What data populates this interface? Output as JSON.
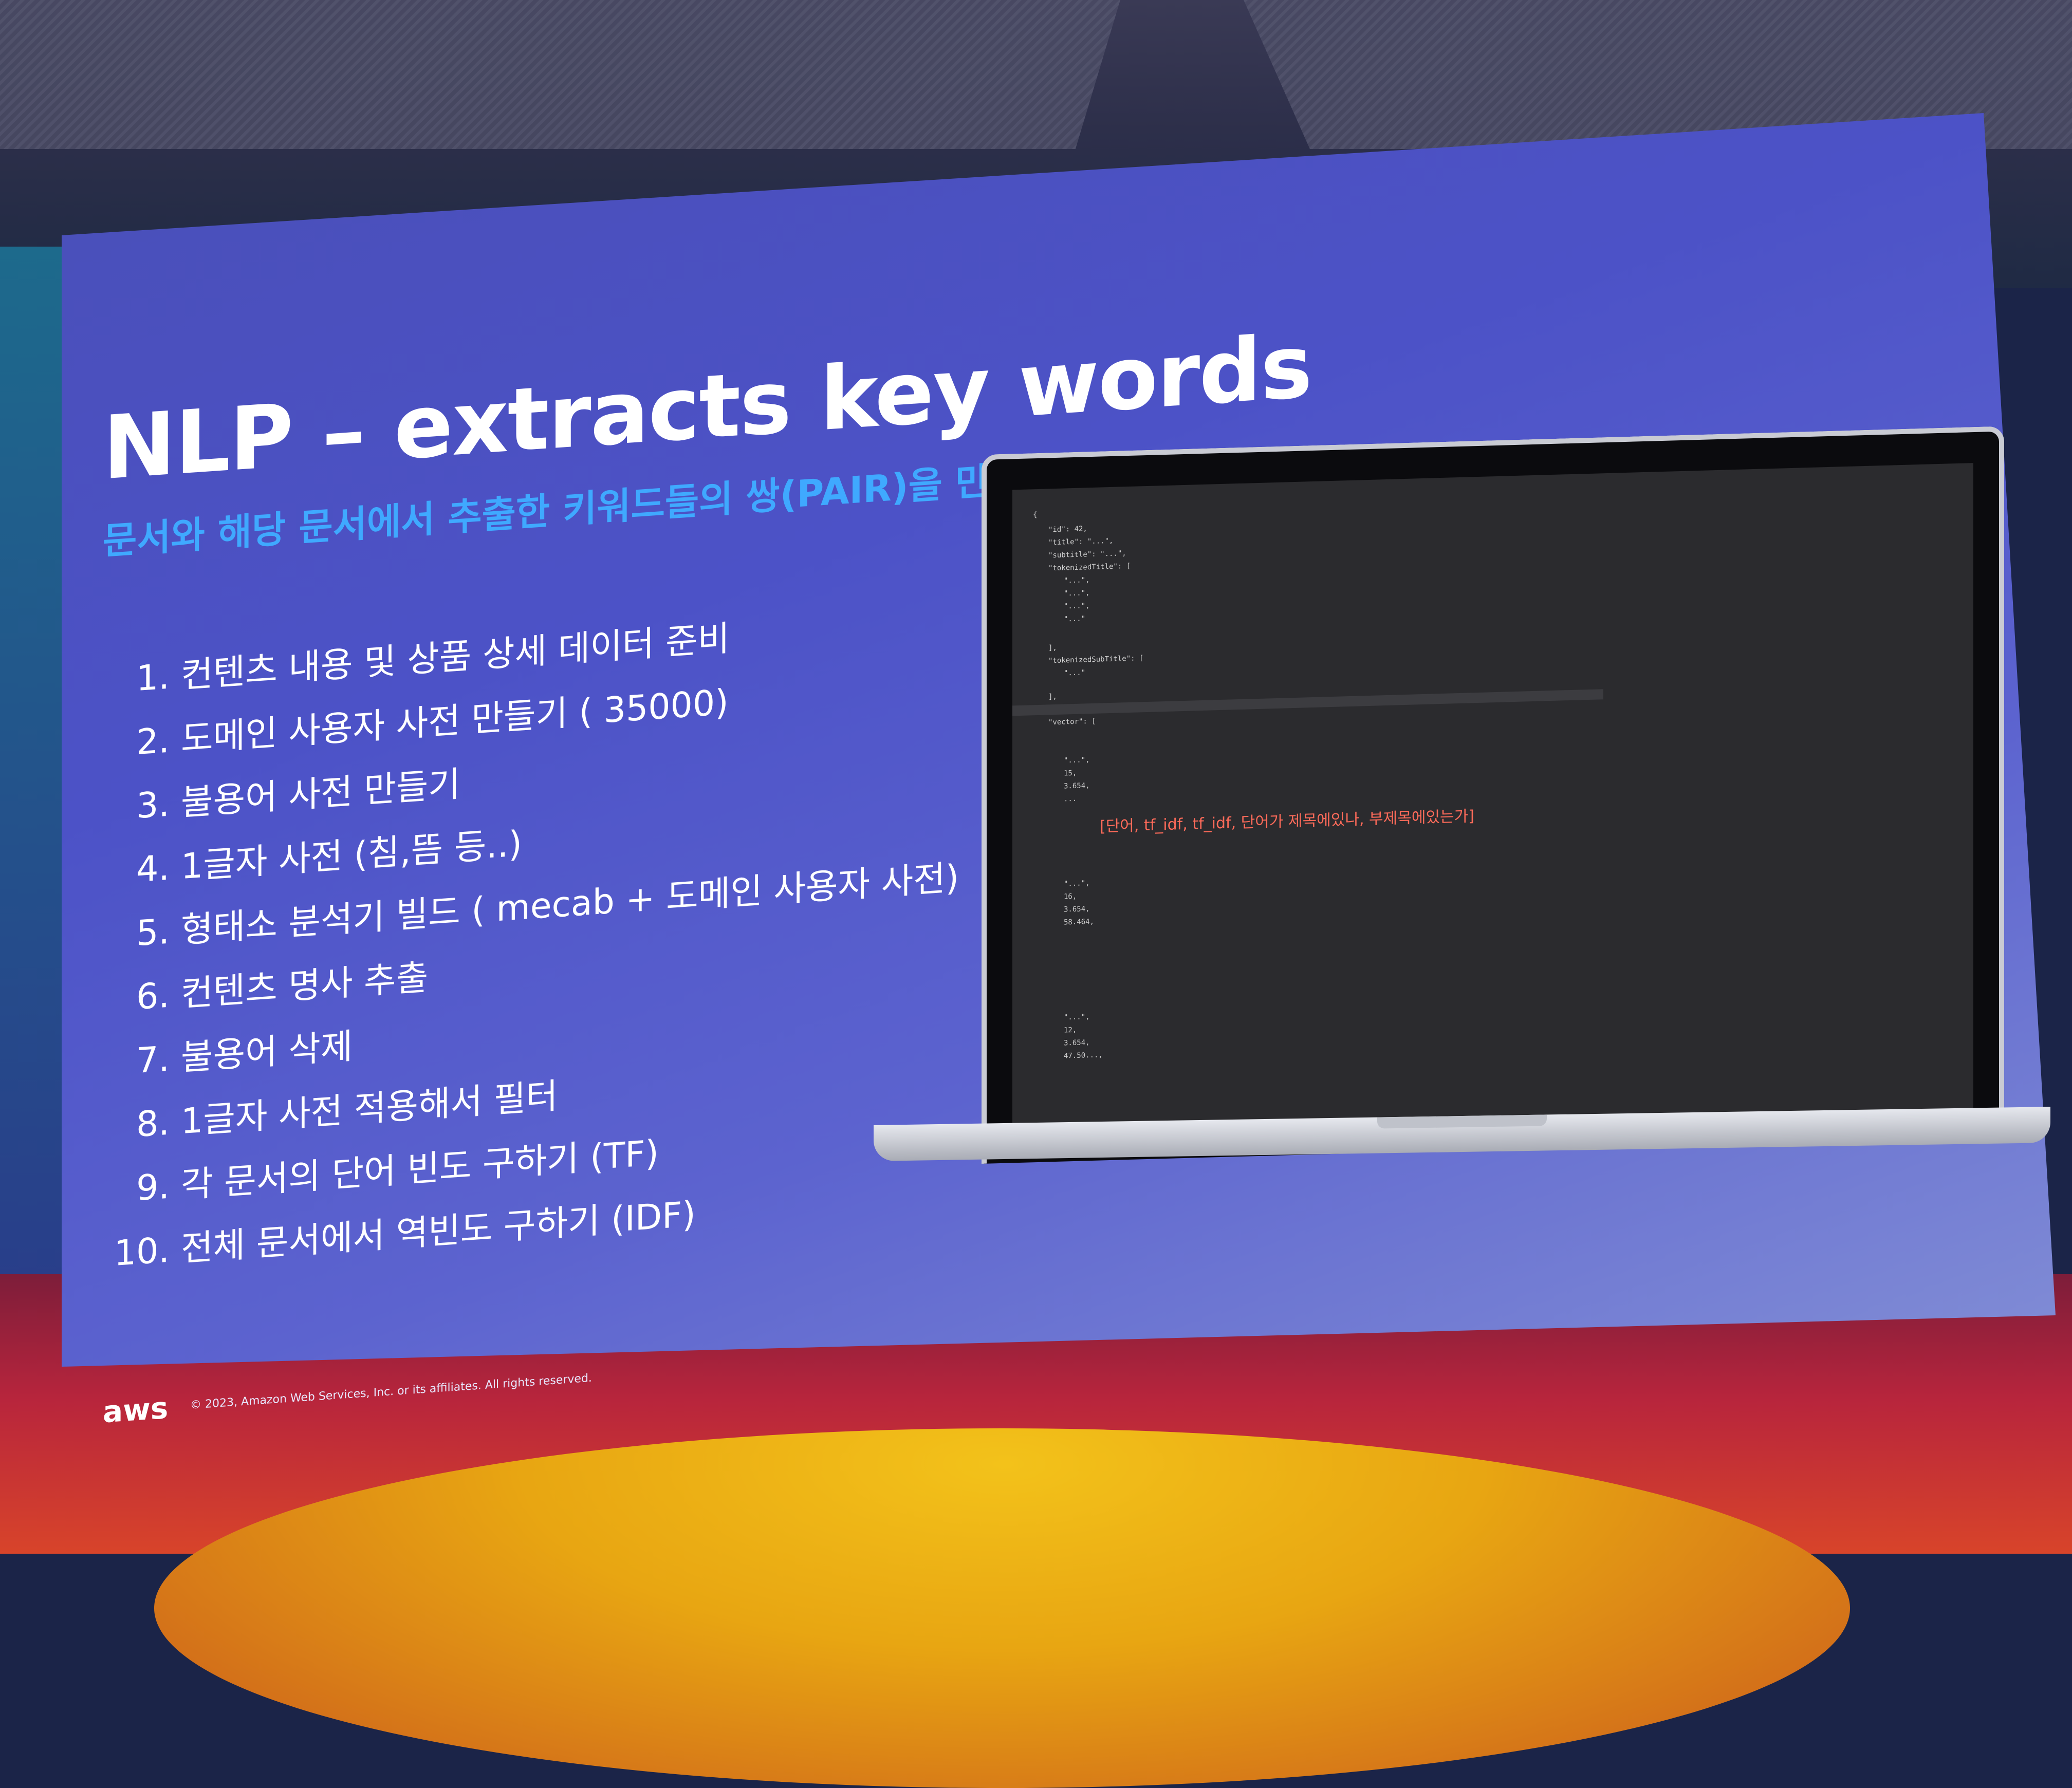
{
  "slide": {
    "title": "NLP – extracts key words",
    "subtitle": "문서와 해당 문서에서 추출한 키워드들의 쌍(PAIR)을 만듭니다.",
    "steps": [
      {
        "num": "1.",
        "text": "컨텐츠 내용 및 상품 상세 데이터 준비"
      },
      {
        "num": "2.",
        "text": "도메인 사용자 사전 만들기 ( 35000)"
      },
      {
        "num": "3.",
        "text": "불용어 사전 만들기"
      },
      {
        "num": "4.",
        "text": "1글자 사전 (침,뜸 등..)"
      },
      {
        "num": "5.",
        "text": "형태소 분석기 빌드 ( mecab + 도메인 사용자 사전)"
      },
      {
        "num": "6.",
        "text": "컨텐츠 명사 추출"
      },
      {
        "num": "7.",
        "text": "불용어 삭제"
      },
      {
        "num": "8.",
        "text": "1글자 사전 적용해서 필터"
      },
      {
        "num": "9.",
        "text": "각 문서의 단어 빈도 구하기 (TF)"
      },
      {
        "num": "10.",
        "text": "전체 문서에서 역빈도 구하기 (IDF)"
      }
    ],
    "footer_logo": "aws",
    "footer_copyright": "© 2023, Amazon Web Services, Inc. or its affiliates. All rights reserved."
  },
  "laptop": {
    "annotation": "[단어, tf_idf, tf_idf, 단어가 제목에있나, 부제목에있는가]"
  },
  "colors": {
    "slide_bg": "#4c52c7",
    "title": "#ffffff",
    "subtitle": "#3fa9ff",
    "annotation": "#ff6b5a"
  }
}
